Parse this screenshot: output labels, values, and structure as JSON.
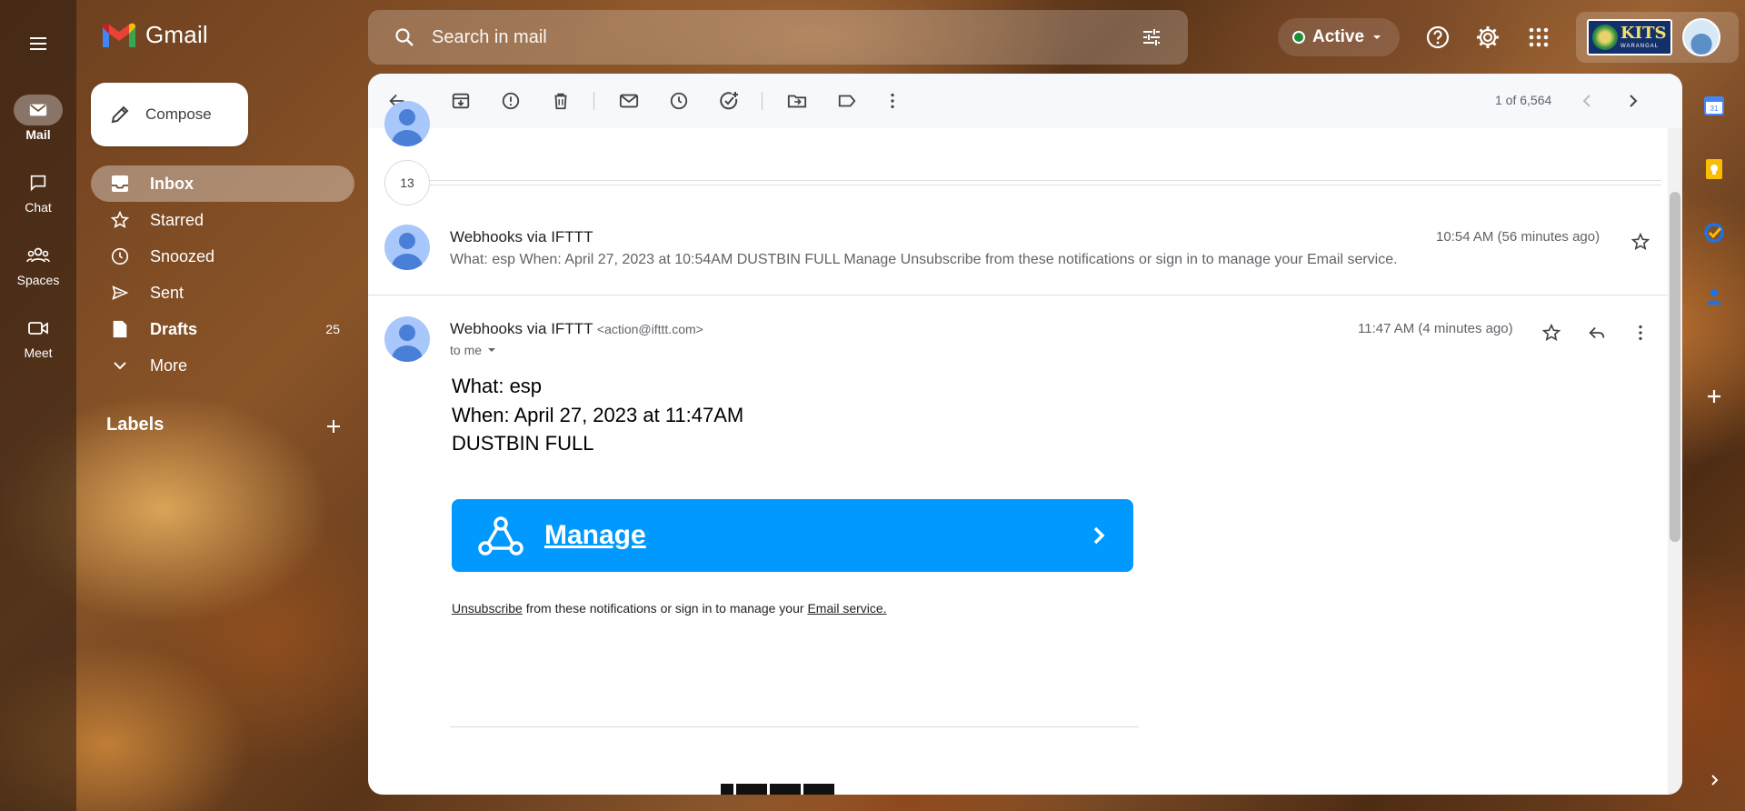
{
  "rail": {
    "items": [
      {
        "label": "Mail",
        "icon": "mail-icon"
      },
      {
        "label": "Chat",
        "icon": "chat-icon"
      },
      {
        "label": "Spaces",
        "icon": "spaces-icon"
      },
      {
        "label": "Meet",
        "icon": "meet-icon"
      }
    ]
  },
  "header": {
    "logo_text": "Gmail",
    "search_placeholder": "Search in mail",
    "status": "Active",
    "org_logo_text": "KITS",
    "org_logo_sub": "WARANGAL"
  },
  "sidebar": {
    "compose": "Compose",
    "items": [
      {
        "label": "Inbox",
        "count": ""
      },
      {
        "label": "Starred",
        "count": ""
      },
      {
        "label": "Snoozed",
        "count": ""
      },
      {
        "label": "Sent",
        "count": ""
      },
      {
        "label": "Drafts",
        "count": "25"
      },
      {
        "label": "More",
        "count": ""
      }
    ],
    "labels_heading": "Labels"
  },
  "toolbar": {
    "pager": "1 of 6,564"
  },
  "thread": {
    "collapsed_count": "13",
    "prev_message": {
      "sender": "Webhooks via IFTTT",
      "snippet": "What: esp When: April 27, 2023 at 10:54AM DUSTBIN FULL Manage Unsubscribe from these notifications or sign in to manage your Email service.",
      "time": "10:54 AM (56 minutes ago)"
    },
    "open_message": {
      "sender": "Webhooks via IFTTT",
      "email": "<action@ifttt.com>",
      "to": "to me",
      "time": "11:47 AM (4 minutes ago)",
      "body": [
        "What: esp",
        "When: April 27, 2023 at 11:47AM",
        "DUSTBIN FULL"
      ],
      "button_label": "Manage",
      "footer": {
        "unsubscribe": "Unsubscribe",
        "middle": " from these notifications or sign in to manage your ",
        "service": "Email service."
      }
    }
  },
  "colors": {
    "ifttt_blue": "#0099ff",
    "active_green": "#1e8e3e"
  }
}
